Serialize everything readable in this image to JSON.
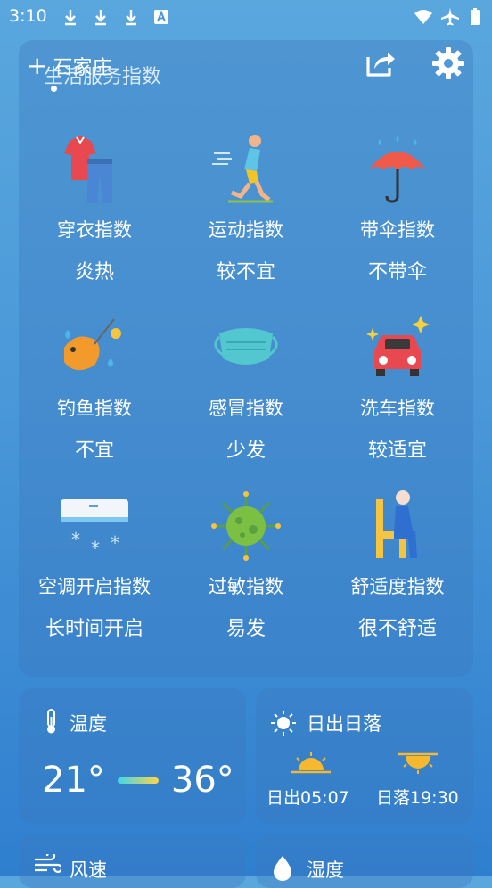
{
  "status_bar": {
    "time": "3:10"
  },
  "header": {
    "city": "石家庄",
    "subtitle": "生活服务指数"
  },
  "indices": [
    {
      "name": "穿衣指数",
      "value": "炎热",
      "icon": "clothing-icon"
    },
    {
      "name": "运动指数",
      "value": "较不宜",
      "icon": "running-icon"
    },
    {
      "name": "带伞指数",
      "value": "不带伞",
      "icon": "umbrella-icon"
    },
    {
      "name": "钓鱼指数",
      "value": "不宜",
      "icon": "fishing-icon"
    },
    {
      "name": "感冒指数",
      "value": "少发",
      "icon": "mask-icon"
    },
    {
      "name": "洗车指数",
      "value": "较适宜",
      "icon": "car-wash-icon"
    },
    {
      "name": "空调开启指数",
      "value": "长时间开启",
      "icon": "air-conditioner-icon"
    },
    {
      "name": "过敏指数",
      "value": "易发",
      "icon": "virus-icon"
    },
    {
      "name": "舒适度指数",
      "value": "很不舒适",
      "icon": "comfort-chair-icon"
    }
  ],
  "temperature": {
    "title": "温度",
    "low": "21°",
    "high": "36°"
  },
  "sun": {
    "title": "日出日落",
    "sunrise": "日出05:07",
    "sunset": "日落19:30"
  },
  "wind": {
    "title": "风速"
  },
  "humidity": {
    "title": "湿度"
  },
  "colors": {
    "background_top": "#5aa7de",
    "background_bottom": "#2f7fd0",
    "temp_bar_start": "#3fd6e8",
    "temp_bar_end": "#ffd34a"
  }
}
